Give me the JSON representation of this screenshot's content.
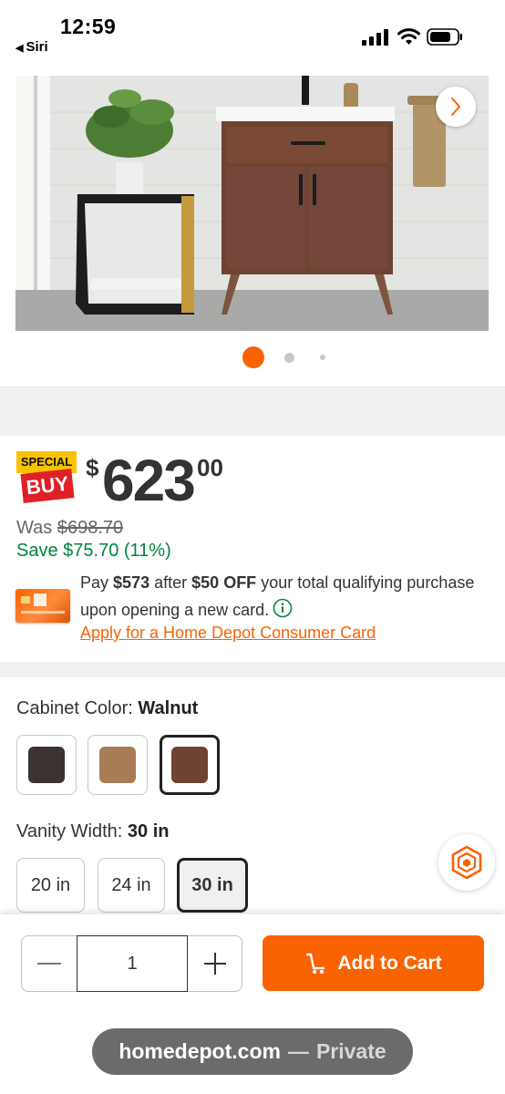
{
  "status_bar": {
    "time": "12:59",
    "back_label": "Siri"
  },
  "gallery": {
    "image_alt": "Walnut bathroom vanity in a bathroom setting",
    "slide_count": 3,
    "active_slide": 1
  },
  "pricing": {
    "badge_top": "SPECIAL",
    "badge_bottom": "BUY",
    "currency_symbol": "$",
    "price_dollars": "623",
    "price_cents": "00",
    "was_label": "Was",
    "was_price": "$698.70",
    "save_text": "Save $75.70 (11%)",
    "card_offer": {
      "prefix": "Pay",
      "pay_amount": "$573",
      "middle": "after",
      "off_amount": "$50 OFF",
      "suffix": "your total qualifying purchase upon opening a new card."
    },
    "apply_link": "Apply for a Home Depot Consumer Card"
  },
  "options": {
    "color": {
      "label": "Cabinet Color:",
      "selected": "Walnut",
      "swatches": [
        {
          "name": "Dark",
          "color": "#3a3330"
        },
        {
          "name": "Light Oak",
          "color": "#a87c55"
        },
        {
          "name": "Walnut",
          "color": "#6e4332"
        }
      ]
    },
    "width": {
      "label": "Vanity Width:",
      "selected": "30 in",
      "sizes": [
        "20 in",
        "24 in",
        "30 in"
      ]
    }
  },
  "cart": {
    "quantity": "1",
    "add_to_cart_label": "Add to Cart"
  },
  "browser": {
    "domain": "homedepot.com",
    "separator": "—",
    "mode": "Private"
  },
  "colors": {
    "brand_orange": "#f96302",
    "save_green": "#00843d",
    "special_yellow": "#f9c200",
    "special_red": "#e01f26"
  }
}
